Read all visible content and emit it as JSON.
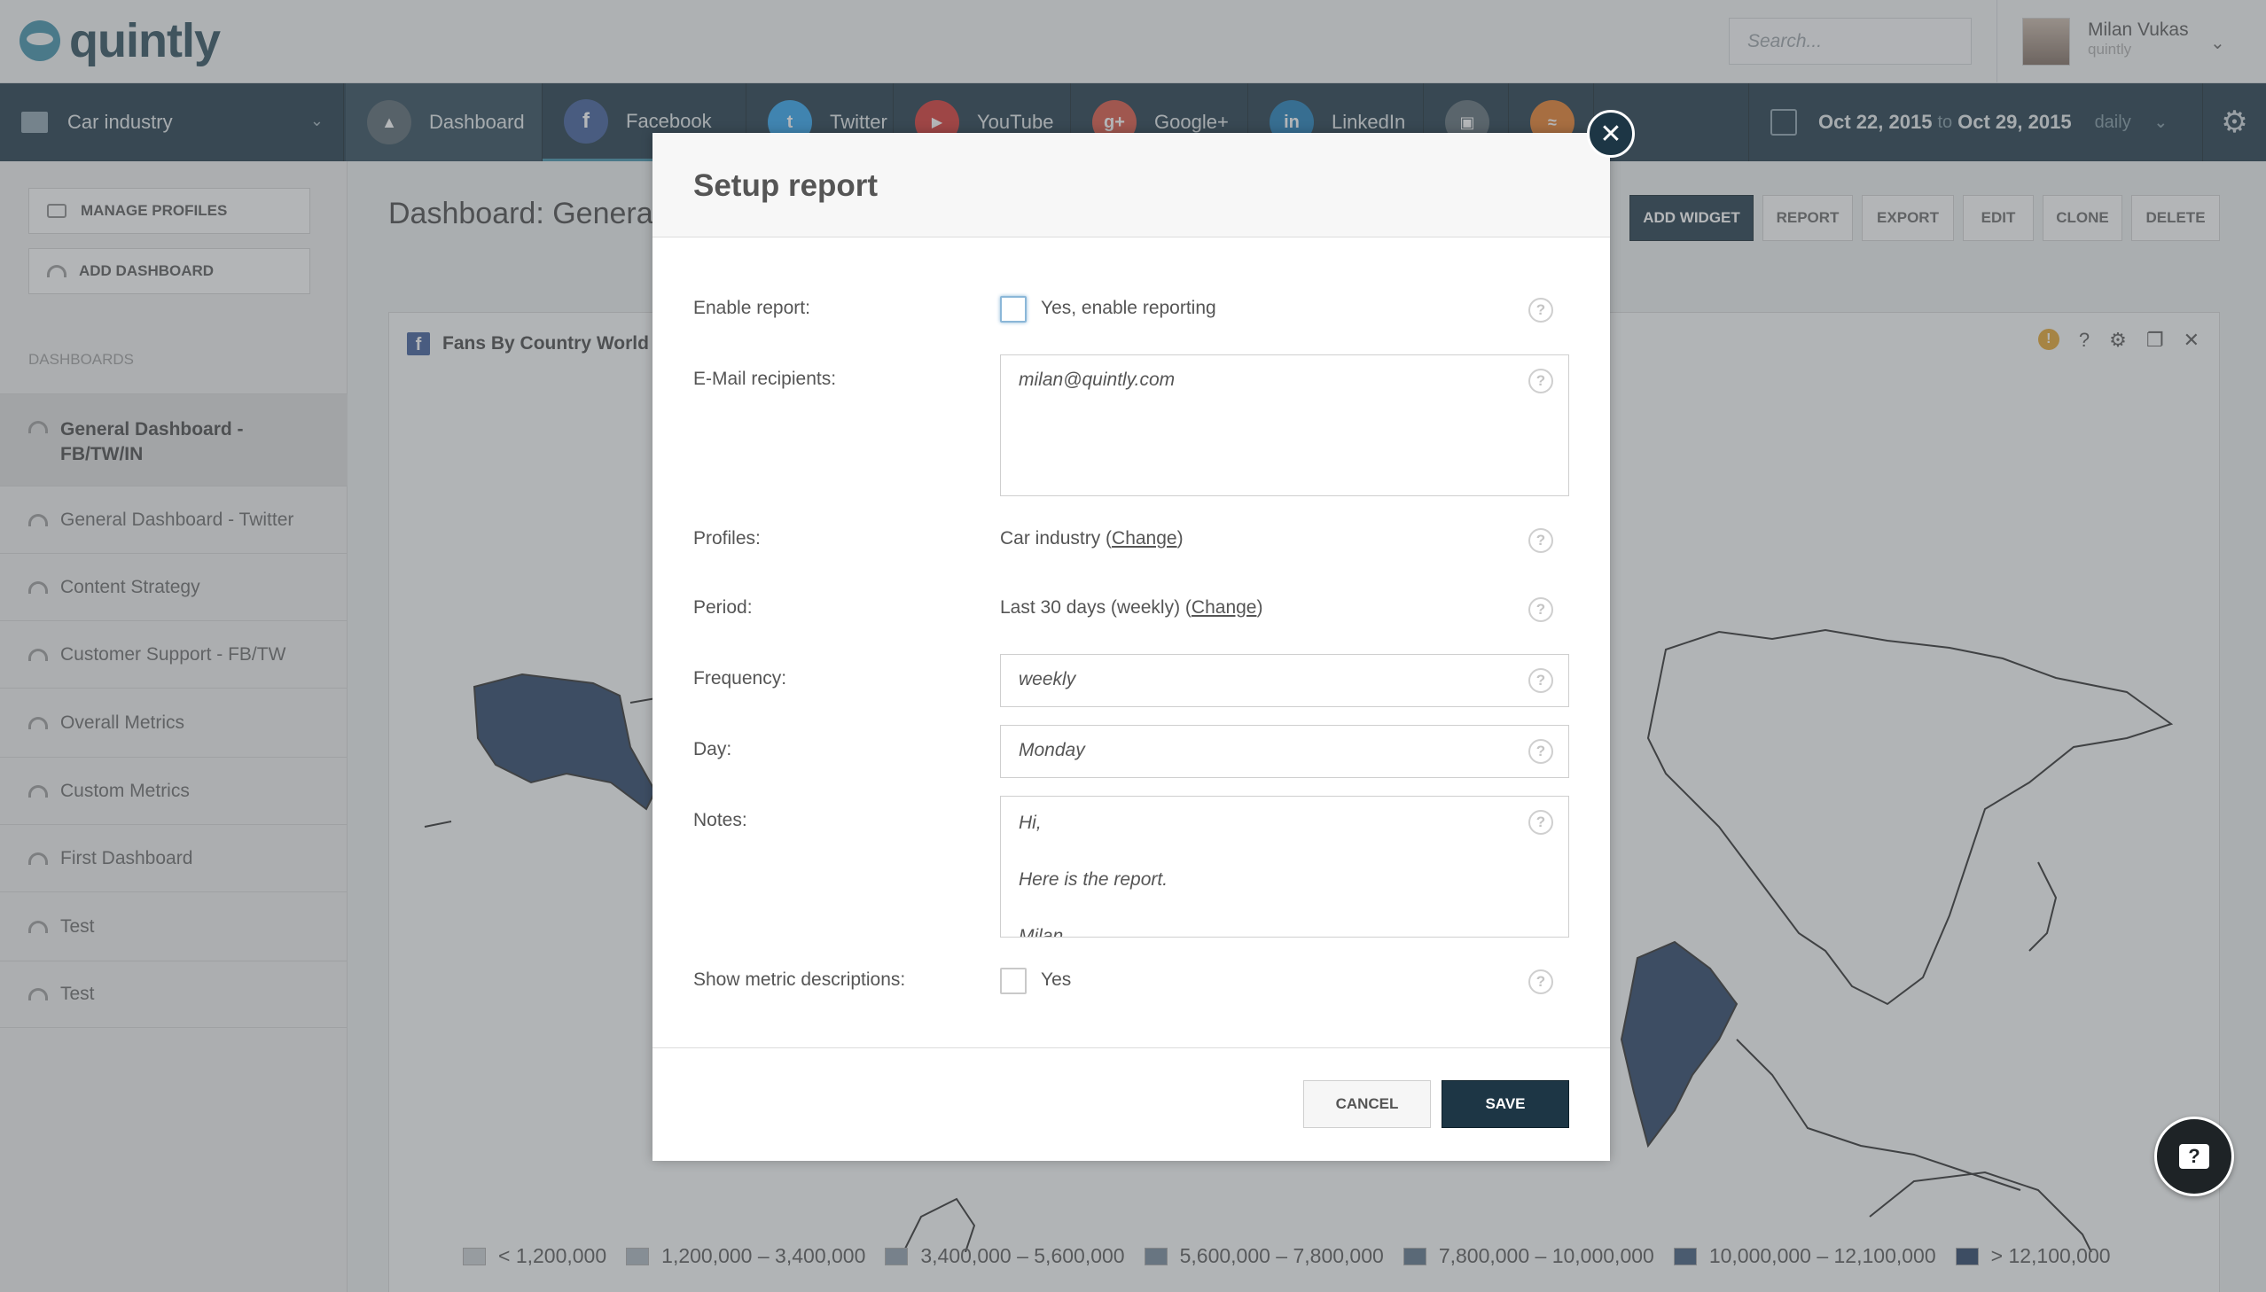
{
  "app": {
    "brand": "quintly"
  },
  "header": {
    "search_placeholder": "Search...",
    "user_name": "Milan Vukas",
    "user_org": "quintly"
  },
  "nav": {
    "profile_group": "Car industry",
    "tabs": [
      {
        "label": "Dashboard",
        "icon": "dashboard-icon",
        "color": "#55656d"
      },
      {
        "label": "Facebook",
        "icon": "facebook-icon",
        "color": "#3b5998"
      },
      {
        "label": "Twitter",
        "icon": "twitter-icon",
        "color": "#2aa3ef"
      },
      {
        "label": "YouTube",
        "icon": "youtube-icon",
        "color": "#d6322f"
      },
      {
        "label": "Google+",
        "icon": "googleplus-icon",
        "color": "#d9503f"
      },
      {
        "label": "LinkedIn",
        "icon": "linkedin-icon",
        "color": "#1a7ab6"
      },
      {
        "label": "",
        "icon": "instagram-icon",
        "color": "#5a6b73"
      },
      {
        "label": "",
        "icon": "rss-icon",
        "color": "#e57a26"
      }
    ],
    "date_from": "Oct 22, 2015",
    "date_to_word": "to",
    "date_to": "Oct 29, 2015",
    "granularity": "daily"
  },
  "sidebar": {
    "buttons": [
      "MANAGE PROFILES",
      "ADD DASHBOARD"
    ],
    "heading": "DASHBOARDS",
    "items": [
      "General Dashboard - FB/TW/IN",
      "General Dashboard - Twitter",
      "Content Strategy",
      "Customer Support - FB/TW",
      "Overall Metrics",
      "Custom Metrics",
      "First Dashboard",
      "Test",
      "Test"
    ]
  },
  "main": {
    "page_title": "Dashboard: General",
    "actions": [
      "ADD WIDGET",
      "REPORT",
      "EXPORT",
      "EDIT",
      "CLONE",
      "DELETE"
    ],
    "widget_title": "Fans By Country World Ma",
    "legend": [
      {
        "label": "< 1,200,000",
        "color": "#c9ced2"
      },
      {
        "label": "1,200,000 – 3,400,000",
        "color": "#a9b4bd"
      },
      {
        "label": "3,400,000 – 5,600,000",
        "color": "#8e9dab"
      },
      {
        "label": "5,600,000 – 7,800,000",
        "color": "#73879a"
      },
      {
        "label": "7,800,000 – 10,000,000",
        "color": "#5a7188"
      },
      {
        "label": "10,000,000 – 12,100,000",
        "color": "#3d5878"
      },
      {
        "label": "> 12,100,000",
        "color": "#253f63"
      }
    ]
  },
  "modal": {
    "title": "Setup report",
    "enable_label": "Enable report:",
    "enable_option": "Yes, enable reporting",
    "recipients_label": "E-Mail recipients:",
    "recipients_value": "milan@quintly.com",
    "profiles_label": "Profiles:",
    "profiles_value": "Car industry",
    "profiles_change": "Change",
    "period_label": "Period:",
    "period_value": "Last 30 days (weekly)",
    "period_change": "Change",
    "frequency_label": "Frequency:",
    "frequency_value": "weekly",
    "day_label": "Day:",
    "day_value": "Monday",
    "notes_label": "Notes:",
    "notes_lines": [
      "Hi,",
      "Here is the report.",
      "Milan"
    ],
    "metric_label": "Show metric descriptions:",
    "metric_option": "Yes",
    "cancel": "CANCEL",
    "save": "SAVE"
  }
}
